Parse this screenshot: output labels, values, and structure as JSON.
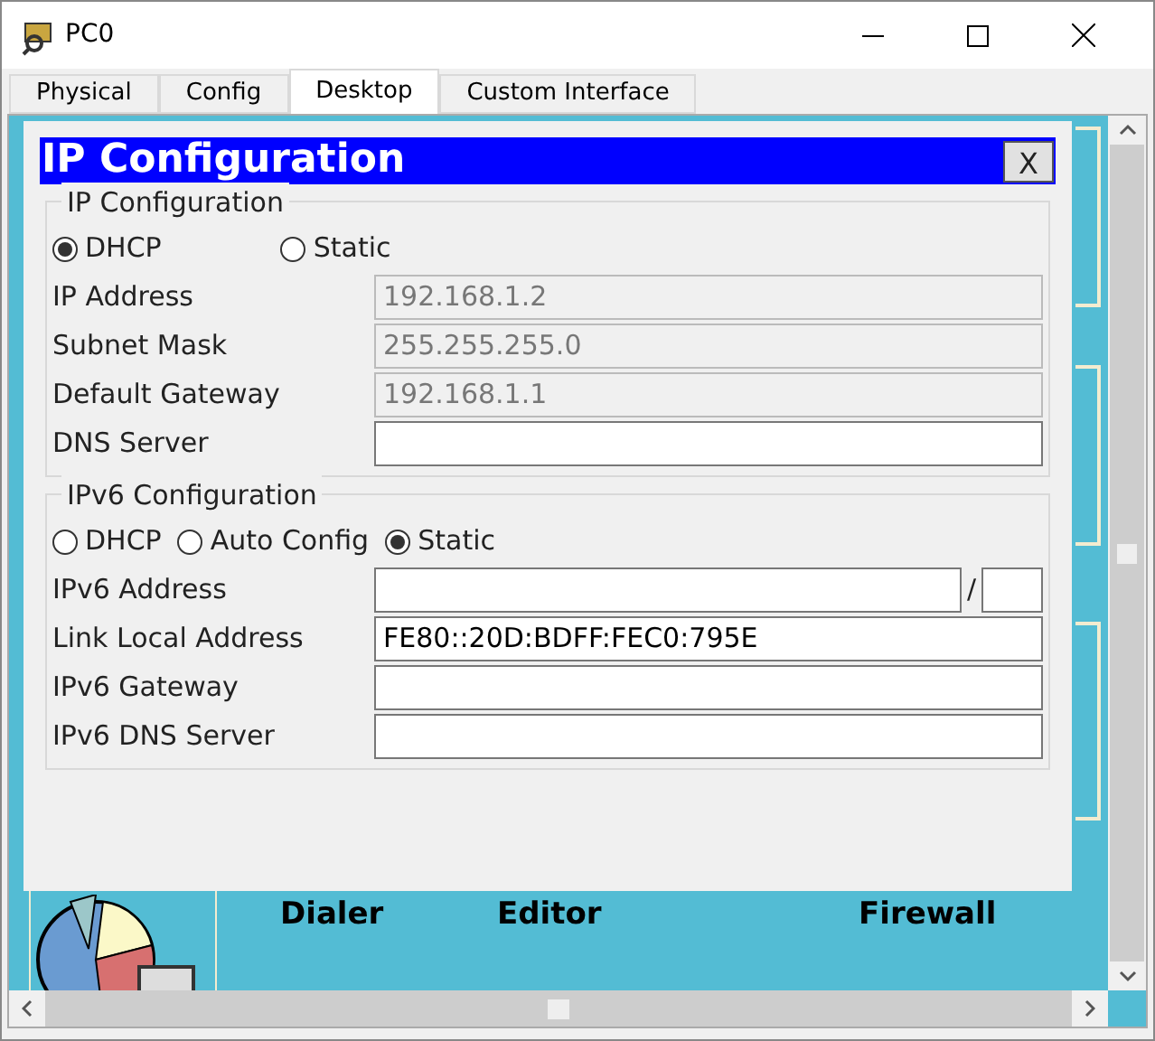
{
  "window": {
    "title": "PC0"
  },
  "tabs": [
    {
      "label": "Physical",
      "selected": false
    },
    {
      "label": "Config",
      "selected": false
    },
    {
      "label": "Desktop",
      "selected": true
    },
    {
      "label": "Custom Interface",
      "selected": false
    }
  ],
  "desktop_labels": [
    "Dialer",
    "Editor",
    "Firewall"
  ],
  "dialog": {
    "title": "IP Configuration",
    "close": "X",
    "ipv4": {
      "title": "IP Configuration",
      "modes": [
        {
          "label": "DHCP",
          "selected": true
        },
        {
          "label": "Static",
          "selected": false
        }
      ],
      "fields": [
        {
          "label": "IP Address",
          "value": "192.168.1.2",
          "disabled": true
        },
        {
          "label": "Subnet Mask",
          "value": "255.255.255.0",
          "disabled": true
        },
        {
          "label": "Default Gateway",
          "value": "192.168.1.1",
          "disabled": true
        },
        {
          "label": "DNS Server",
          "disabled": false
        }
      ]
    },
    "ipv6": {
      "title": "IPv6 Configuration",
      "modes": [
        {
          "label": "DHCP",
          "selected": false
        },
        {
          "label": "Auto Config",
          "selected": false
        },
        {
          "label": "Static",
          "selected": true
        }
      ],
      "fields": [
        {
          "label": "IPv6 Address",
          "disabled": false,
          "separator": "/"
        },
        {
          "label": "Link Local Address",
          "value": "FE80::20D:BDFF:FEC0:795E",
          "disabled": false
        },
        {
          "label": "IPv6 Gateway",
          "disabled": false
        },
        {
          "label": "IPv6 DNS Server",
          "disabled": false
        }
      ]
    }
  }
}
